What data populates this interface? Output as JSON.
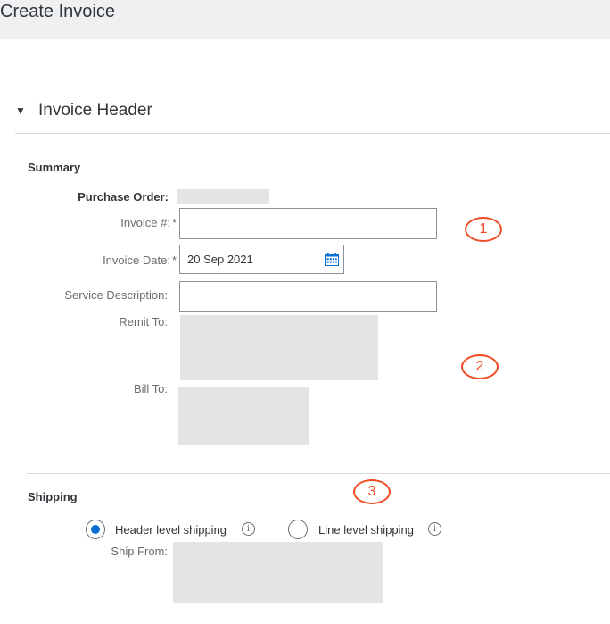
{
  "window": {
    "title": "Create Invoice"
  },
  "invoice_header": {
    "toggle_glyph": "▼",
    "label": "Invoice Header"
  },
  "summary": {
    "title": "Summary",
    "purchase_order_label": "Purchase Order:",
    "invoice_number_label": "Invoice #:",
    "invoice_number_value": "",
    "invoice_date_label": "Invoice Date:",
    "invoice_date_value": "20 Sep 2021",
    "service_description_label": "Service Description:",
    "service_description_value": "",
    "remit_to_label": "Remit To:",
    "bill_to_label": "Bill To:",
    "required_marker": "*",
    "calendar_icon": "calendar-icon"
  },
  "shipping": {
    "title": "Shipping",
    "header_level_label": "Header level shipping",
    "line_level_label": "Line level shipping",
    "selected": "header",
    "ship_from_label": "Ship From:",
    "info_glyph": "i"
  },
  "annotations": {
    "callout_1": "1",
    "callout_2": "2",
    "callout_3": "3",
    "color": "#f04a23"
  },
  "colors": {
    "accent": "#0a6ed1",
    "title_bar": "#eff0f1",
    "redaction": "#e5e3e3"
  }
}
